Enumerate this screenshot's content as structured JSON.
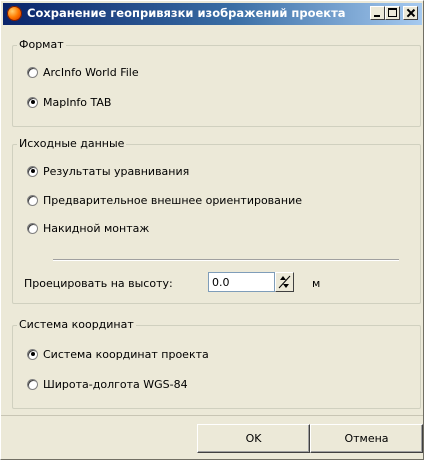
{
  "window": {
    "title": "Сохранение геопривязки изображений проекта"
  },
  "format_group": {
    "legend": "Формат",
    "options": [
      {
        "label": "ArcInfo World File",
        "checked": false
      },
      {
        "label": "MapInfo TAB",
        "checked": true
      }
    ]
  },
  "source_group": {
    "legend": "Исходные данные",
    "options": [
      {
        "label": "Результаты уравнивания",
        "checked": true
      },
      {
        "label": "Предварительное внешнее ориентирование",
        "checked": false
      },
      {
        "label": "Накидной монтаж",
        "checked": false
      }
    ],
    "projection": {
      "label": "Проецировать на высоту:",
      "value": "0.0",
      "unit": "м"
    }
  },
  "coord_group": {
    "legend": "Система координат",
    "options": [
      {
        "label": "Система координат проекта",
        "checked": true
      },
      {
        "label": "Широта-долгота WGS-84",
        "checked": false
      }
    ]
  },
  "buttons": {
    "ok": "OK",
    "cancel": "Отмена"
  }
}
